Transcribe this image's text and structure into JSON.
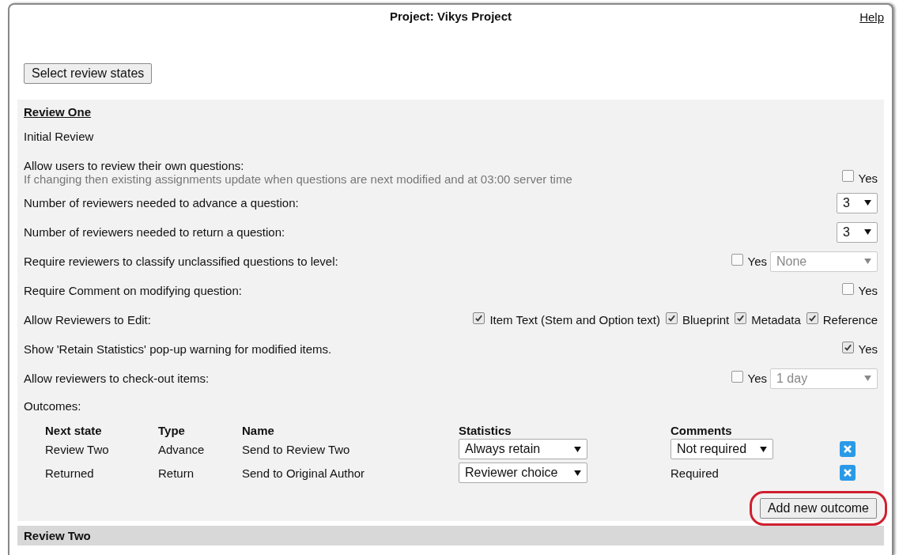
{
  "header": {
    "title": "Project: Vikys Project",
    "help_link": "Help"
  },
  "select_states_button": "Select review states",
  "review": {
    "heading": "Review One",
    "description": "Initial Review",
    "settings": [
      {
        "kind": "check",
        "label": "Allow users to review their own questions:",
        "note": "If changing then existing assignments update when questions are next modified and at 03:00 server time",
        "checks": [
          {
            "label": "Yes",
            "checked": false
          }
        ]
      },
      {
        "kind": "select",
        "label": "Number of reviewers needed to advance a question:",
        "select": {
          "value": "3",
          "disabled": false
        }
      },
      {
        "kind": "select",
        "label": "Number of reviewers needed to return a question:",
        "select": {
          "value": "3",
          "disabled": false
        }
      },
      {
        "kind": "check_select",
        "label": "Require reviewers to classify unclassified questions to level:",
        "checks": [
          {
            "label": "Yes",
            "checked": false
          }
        ],
        "select": {
          "value": "None",
          "disabled": true
        }
      },
      {
        "kind": "check",
        "label": "Require Comment on modifying question:",
        "checks": [
          {
            "label": "Yes",
            "checked": false
          }
        ]
      },
      {
        "kind": "check",
        "label": "Allow Reviewers to Edit:",
        "checks": [
          {
            "label": "Item Text (Stem and Option text)",
            "checked": true
          },
          {
            "label": "Blueprint",
            "checked": true
          },
          {
            "label": "Metadata",
            "checked": true
          },
          {
            "label": "Reference",
            "checked": true
          }
        ]
      },
      {
        "kind": "check",
        "label": "Show 'Retain Statistics' pop-up warning for modified items.",
        "checks": [
          {
            "label": "Yes",
            "checked": true
          }
        ]
      },
      {
        "kind": "check_select",
        "label": "Allow reviewers to check-out items:",
        "checks": [
          {
            "label": "Yes",
            "checked": false
          }
        ],
        "select": {
          "value": "1 day",
          "disabled": true
        }
      }
    ],
    "outcomes_label": "Outcomes:",
    "outcomes_columns": [
      "Next state",
      "Type",
      "Name",
      "Statistics",
      "Comments"
    ],
    "outcomes": [
      {
        "next_state": "Review Two",
        "type": "Advance",
        "name": "Send to Review Two",
        "statistics": "Always retain",
        "kind": "select",
        "comments": "Not required"
      },
      {
        "next_state": "Returned",
        "type": "Return",
        "name": "Send to Original Author",
        "statistics": "Reviewer choice",
        "kind": "text",
        "comments": "Required"
      }
    ],
    "add_outcome_button": "Add new outcome"
  },
  "next_review_heading": "Review Two"
}
